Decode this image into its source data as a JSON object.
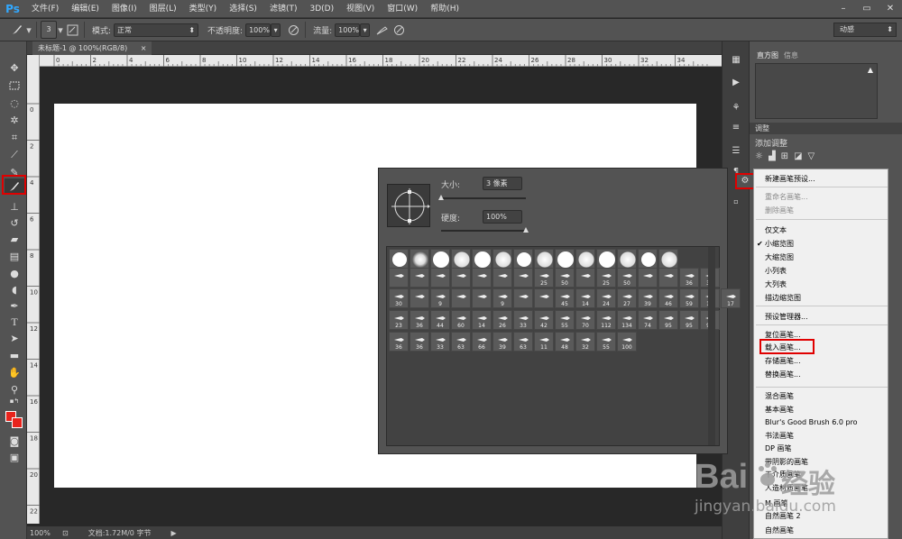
{
  "app": {
    "logo": "Ps"
  },
  "menu": [
    "文件(F)",
    "编辑(E)",
    "图像(I)",
    "图层(L)",
    "类型(Y)",
    "选择(S)",
    "滤镜(T)",
    "3D(D)",
    "视图(V)",
    "窗口(W)",
    "帮助(H)"
  ],
  "window_controls": {
    "minimize": "–",
    "restore": "▭",
    "close": "✕"
  },
  "options": {
    "brush_size": "3",
    "mode_label": "模式:",
    "mode_value": "正常",
    "opacity_label": "不透明度:",
    "opacity_value": "100%",
    "flow_label": "流量:",
    "flow_value": "100%",
    "workspace": "动感"
  },
  "document": {
    "tab_label": "未标题-1 @ 100%(RGB/8)",
    "tab_close": "×",
    "zoom": "100%",
    "doc_info": "文档:1.72M/0 字节",
    "ruler_top": [
      "0",
      "2",
      "4",
      "6",
      "8",
      "10",
      "12",
      "14",
      "16",
      "18",
      "20",
      "22",
      "24",
      "26",
      "28",
      "30",
      "32",
      "34"
    ],
    "ruler_left": [
      "0",
      "2",
      "4",
      "6",
      "8",
      "10",
      "12",
      "14",
      "16",
      "18",
      "20",
      "22",
      "24"
    ]
  },
  "right_panel": {
    "tab_histogram": "直方图",
    "tab_info": "信息",
    "warning": "▲",
    "adjust_tab": "调整",
    "adjust_add": "添加调整"
  },
  "brush_panel": {
    "size_label": "大小:",
    "size_value": "3 像素",
    "hardness_label": "硬度:",
    "hardness_value": "100%",
    "size_fraction": 0.0,
    "hardness_fraction": 1.0,
    "row1": [
      "",
      "",
      "",
      "",
      "",
      "",
      "",
      "",
      "",
      "",
      "",
      "",
      "",
      ""
    ],
    "row2": [
      "",
      "",
      "",
      "",
      "",
      "",
      "",
      "25",
      "50",
      "",
      "25",
      "50",
      "",
      "",
      "36",
      "30"
    ],
    "row3": [
      "30",
      "",
      "9",
      "",
      "",
      "9",
      "",
      "",
      "45",
      "14",
      "24",
      "27",
      "39",
      "46",
      "59",
      "11",
      "17"
    ],
    "row4": [
      "23",
      "36",
      "44",
      "60",
      "14",
      "26",
      "33",
      "42",
      "55",
      "70",
      "112",
      "134",
      "74",
      "95",
      "95",
      "90"
    ],
    "row5": [
      "36",
      "36",
      "33",
      "63",
      "66",
      "39",
      "63",
      "11",
      "48",
      "32",
      "55",
      "100"
    ]
  },
  "flyout_menu": {
    "items": [
      {
        "label": "新建画笔预设...",
        "disabled": false
      },
      {
        "label": "重命名画笔...",
        "disabled": true
      },
      {
        "label": "删除画笔",
        "disabled": true
      },
      {
        "label": "仅文本",
        "disabled": false
      },
      {
        "label": "小缩览图",
        "disabled": false,
        "checked": true
      },
      {
        "label": "大缩览图",
        "disabled": false
      },
      {
        "label": "小列表",
        "disabled": false
      },
      {
        "label": "大列表",
        "disabled": false
      },
      {
        "label": "描边缩览图",
        "disabled": false
      },
      {
        "label": "预设管理器...",
        "disabled": false
      },
      {
        "label": "复位画笔...",
        "disabled": false
      },
      {
        "label": "载入画笔...",
        "disabled": false
      },
      {
        "label": "存储画笔...",
        "disabled": false
      },
      {
        "label": "替换画笔...",
        "disabled": false
      },
      {
        "label": "混合画笔",
        "disabled": false
      },
      {
        "label": "基本画笔",
        "disabled": false
      },
      {
        "label": "Blur's Good Brush 6.0 pro",
        "disabled": false
      },
      {
        "label": "书法画笔",
        "disabled": false
      },
      {
        "label": "DP 画笔",
        "disabled": false
      },
      {
        "label": "带阴影的画笔",
        "disabled": false
      },
      {
        "label": "干介质画笔",
        "disabled": false
      },
      {
        "label": "人造材质画笔",
        "disabled": false
      },
      {
        "label": "M 画笔",
        "disabled": false
      },
      {
        "label": "自然画笔 2",
        "disabled": false
      },
      {
        "label": "自然画笔",
        "disabled": false
      }
    ],
    "checkmark": "✔"
  },
  "watermark": {
    "brand": "Bai",
    "brand2": "经验",
    "url": "jingyan.baidu.com"
  },
  "colors": {
    "foreground": "#e8231c",
    "background": "#ffffff",
    "highlight": "#e00000"
  }
}
